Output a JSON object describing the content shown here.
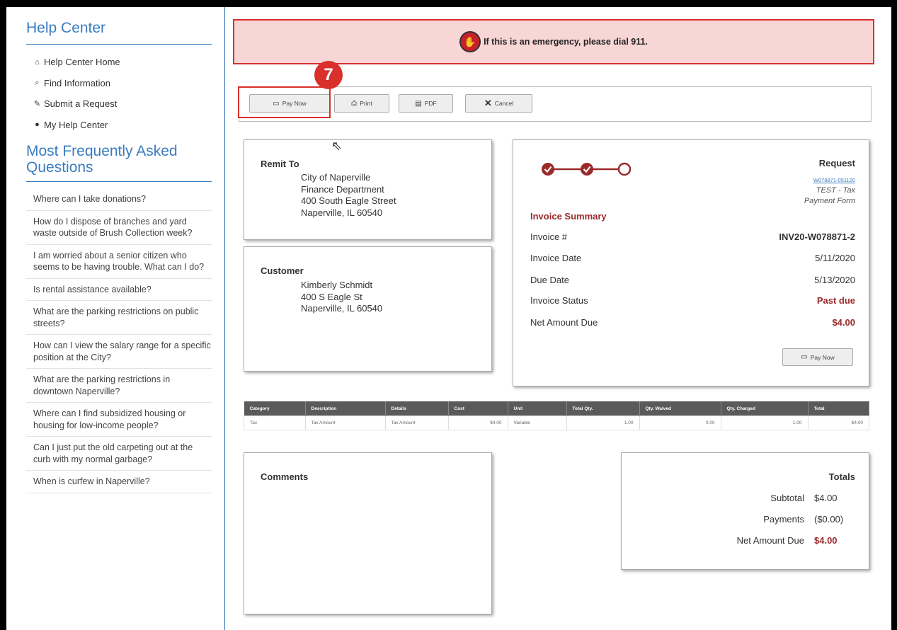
{
  "sidebar": {
    "title": "Help Center",
    "nav": [
      {
        "icon": "home-icon",
        "glyph": "⌂",
        "label": "Help Center Home"
      },
      {
        "icon": "search-icon",
        "glyph": "⌕",
        "label": "Find Information"
      },
      {
        "icon": "edit-icon",
        "glyph": "✎",
        "label": "Submit a Request"
      },
      {
        "icon": "user-icon",
        "glyph": "●",
        "label": "My Help Center"
      }
    ],
    "faq_title": "Most Frequently Asked Questions",
    "faq": [
      "Where can I take donations?",
      "How do I dispose of branches and yard waste outside of Brush Collection week?",
      "I am worried about a senior citizen who seems to be having trouble. What can I do?",
      "Is rental assistance available?",
      "What are the parking restrictions on public streets?",
      "How can I view the salary range for a specific position at the City?",
      "What are the parking restrictions in downtown Naperville?",
      "Where can I find subsidized housing or housing for low-income people?",
      "Can I just put the old carpeting out at the curb with my normal garbage?",
      "When is curfew in Naperville?"
    ]
  },
  "alert": {
    "text": "If this is an emergency, please dial 911."
  },
  "step_badge": "7",
  "toolbar": {
    "pay_now": "Pay Now",
    "print": "Print",
    "pdf": "PDF",
    "cancel": "Cancel"
  },
  "remit": {
    "heading": "Remit To",
    "lines": [
      "City of Naperville",
      "Finance Department",
      "400 South Eagle Street",
      "Naperville, IL 60540"
    ]
  },
  "customer": {
    "heading": "Customer",
    "lines": [
      "Kimberly Schmidt",
      "400 S Eagle St",
      "Naperville, IL  60540"
    ]
  },
  "invoice": {
    "request_label": "Request",
    "request_id": "W078871-051120",
    "request_name": "TEST - Tax Payment Form",
    "summary_title": "Invoice Summary",
    "progress_steps": [
      true,
      true,
      false
    ],
    "rows": [
      {
        "label": "Invoice #",
        "value": "INV20-W078871-2"
      },
      {
        "label": "Invoice Date",
        "value": "5/11/2020"
      },
      {
        "label": "Due Date",
        "value": "5/13/2020"
      },
      {
        "label": "Invoice Status",
        "value": "Past due"
      },
      {
        "label": "Net Amount Due",
        "value": "$4.00"
      }
    ],
    "pay_now": "Pay Now"
  },
  "line_items": {
    "headers": [
      "Category",
      "Description",
      "Details",
      "Cost",
      "Unit",
      "Total Qty.",
      "Qty. Waived",
      "Qty. Charged",
      "Total"
    ],
    "rows": [
      [
        "Tax",
        "Tax Amount",
        "Tax Amount",
        "$4.00",
        "Variable",
        "1.00",
        "0.00",
        "1.00",
        "$4.00"
      ]
    ]
  },
  "comments": {
    "heading": "Comments"
  },
  "totals": {
    "heading": "Totals",
    "subtotal_label": "Subtotal",
    "subtotal": "$4.00",
    "payments_label": "Payments",
    "payments": "($0.00)",
    "net_label": "Net Amount Due",
    "net": "$4.00"
  },
  "colors": {
    "accent": "#3a7cc0",
    "maroon": "#9b2a2a",
    "alert_bg": "#f9d6d6",
    "alert_border": "#d63030"
  }
}
